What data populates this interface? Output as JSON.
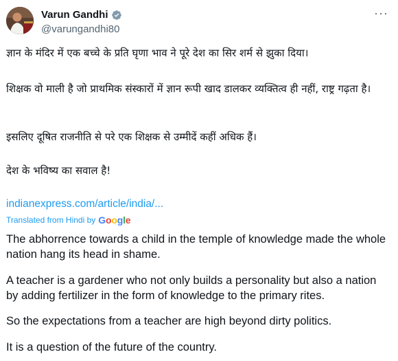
{
  "author": {
    "name": "Varun Gandhi",
    "handle": "@varungandhi80",
    "verified_icon": "verified-badge-icon",
    "avatar_icon": "profile-photo"
  },
  "menu_icon": "more-options-icon",
  "tweet_hindi": [
    "ज्ञान के मंदिर में एक बच्चे के प्रति घृणा भाव ने पूरे देश का सिर शर्म से झुका दिया।",
    "शिक्षक वो माली है जो प्राथमिक संस्कारों में ज्ञान रूपी खाद डालकर व्यक्तित्व ही नहीं, राष्ट्र गढ़ता है।",
    "इसलिए दूषित राजनीति से परे एक शिक्षक से उम्मीदें कहीं अधिक हैं।",
    "देश के भविष्य का सवाल है!"
  ],
  "link_text": "indianexpress.com/article/india/...",
  "translation": {
    "label": "Translated from Hindi by",
    "provider": "Google"
  },
  "tweet_english": [
    "The abhorrence towards a child in the temple of knowledge made the whole nation hang its head in shame.",
    "A teacher is a gardener who not only builds a personality but also a nation by adding fertilizer in the form of knowledge to the primary rites.",
    "So the expectations from a teacher are high beyond dirty politics.",
    "It is a question of the future of the country."
  ],
  "colors": {
    "accent": "#1d9bf0",
    "text": "#0f1419",
    "secondary": "#536471"
  }
}
